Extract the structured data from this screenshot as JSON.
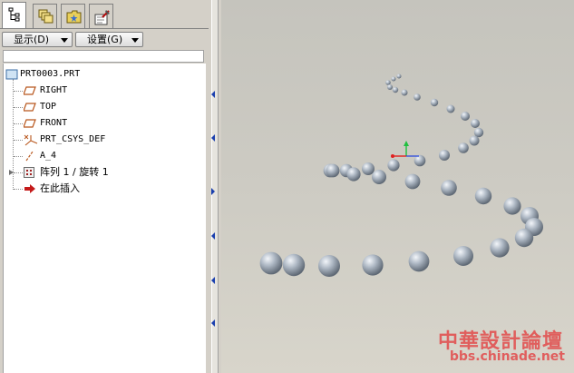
{
  "tabs": [
    {
      "icon": "model-tree-icon",
      "active": true
    },
    {
      "icon": "layers-icon",
      "active": false
    },
    {
      "icon": "favorites-icon",
      "active": false
    },
    {
      "icon": "tools-icon",
      "active": false
    }
  ],
  "toolbar": {
    "display_label": "显示(D)",
    "settings_label": "设置(G)"
  },
  "tree": {
    "root": "PRT0003.PRT",
    "items": [
      {
        "label": "RIGHT",
        "icon": "datum-plane-icon"
      },
      {
        "label": "TOP",
        "icon": "datum-plane-icon"
      },
      {
        "label": "FRONT",
        "icon": "datum-plane-icon"
      },
      {
        "label": "PRT_CSYS_DEF",
        "icon": "coordinate-system-icon"
      },
      {
        "label": "A_4",
        "icon": "datum-axis-icon"
      },
      {
        "label": "阵列 1 / 旋转 1",
        "icon": "pattern-icon"
      },
      {
        "label": "在此插入",
        "icon": "insert-arrow-icon"
      }
    ]
  },
  "watermark": {
    "line1": "中華設計論壇",
    "line2": "bbs.chinade.net"
  },
  "colors": {
    "panel": "#d4d0c8",
    "tree_bg": "#ffffff",
    "sphere": "#9ea7b2",
    "watermark": "#e24a4a",
    "datum_orange": "#b8561c"
  }
}
